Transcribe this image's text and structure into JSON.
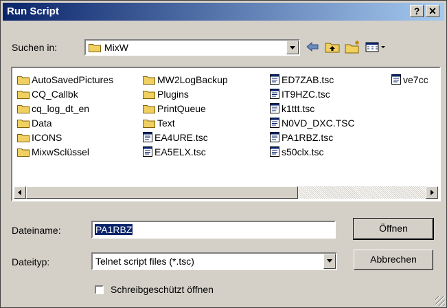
{
  "title": "Run Script",
  "titlebar_buttons": {
    "help": "?",
    "close": "✕"
  },
  "look_in": {
    "label": "Suchen in:",
    "value": "MixW"
  },
  "files": {
    "col1": [
      "AutoSavedPictures",
      "CQ_Callbk",
      "cq_log_dt_en",
      "Data",
      "ICONS",
      "MixwSclüssel"
    ],
    "col2_folders": [
      "MW2LogBackup",
      "Plugins",
      "PrintQueue",
      "Text"
    ],
    "col2_files": [
      "EA4URE.tsc",
      "EA5ELX.tsc"
    ],
    "col3": [
      "ED7ZAB.tsc",
      "IT9HZC.tsc",
      "k1ttt.tsc",
      "N0VD_DXC.TSC",
      "PA1RBZ.tsc",
      "s50clx.tsc"
    ],
    "col4": [
      "ve7cc"
    ]
  },
  "filename": {
    "label": "Dateiname:",
    "value": "PA1RBZ"
  },
  "filetype": {
    "label": "Dateityp:",
    "value": "Telnet script files (*.tsc)"
  },
  "buttons": {
    "open": "Öffnen",
    "cancel": "Abbrechen"
  },
  "readonly": {
    "label": "Schreibgeschützt öffnen",
    "checked": false
  },
  "colors": {
    "title_start": "#0a246a",
    "title_end": "#a6caf0",
    "face": "#d4d0c8",
    "folder": "#f0d060"
  }
}
